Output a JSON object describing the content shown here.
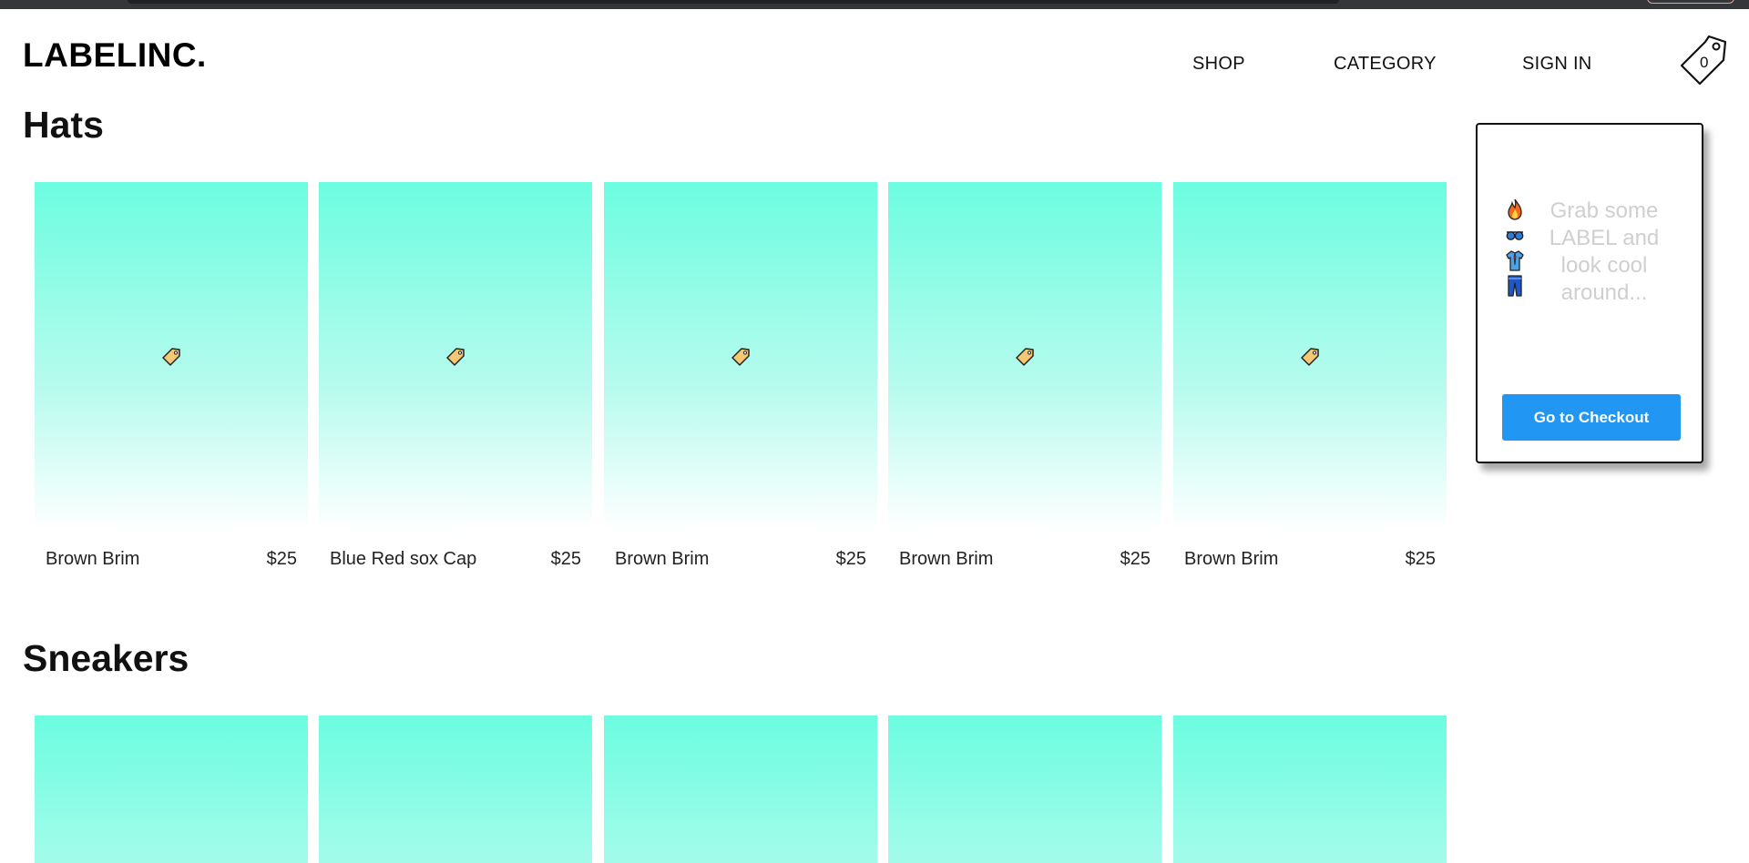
{
  "brand": {
    "logo": "LABELINC."
  },
  "nav": {
    "shop": "SHOP",
    "category": "CATEGORY",
    "signin": "SIGN IN",
    "cart_count": "0"
  },
  "sections": [
    {
      "title": "Hats",
      "items": [
        {
          "name": "Brown Brim",
          "price": "$25",
          "icon": "label-tag-icon"
        },
        {
          "name": "Blue Red sox Cap",
          "price": "$25",
          "icon": "label-tag-icon"
        },
        {
          "name": "Brown Brim",
          "price": "$25",
          "icon": "label-tag-icon"
        },
        {
          "name": "Brown Brim",
          "price": "$25",
          "icon": "label-tag-icon"
        },
        {
          "name": "Brown Brim",
          "price": "$25",
          "icon": "label-tag-icon"
        }
      ]
    },
    {
      "title": "Sneakers",
      "items": [
        {},
        {},
        {},
        {},
        {}
      ]
    }
  ],
  "cart_dropdown": {
    "empty_message": "Grab some LABEL and look cool around...",
    "emojis": [
      "fire-icon",
      "sunglasses-icon",
      "shirt-icon",
      "jeans-icon"
    ],
    "checkout_label": "Go to Checkout"
  },
  "colors": {
    "card_gradient_top": "#6cfde0",
    "card_gradient_bottom": "#ffffff",
    "checkout_button": "#2196f3",
    "empty_text": "#cfcfcf"
  }
}
